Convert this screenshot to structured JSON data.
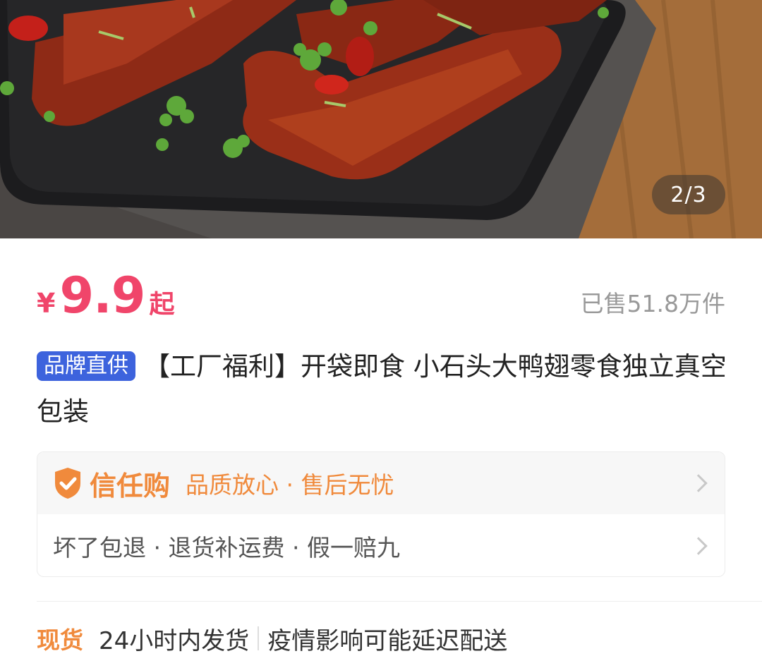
{
  "gallery": {
    "counter": "2/3",
    "image_desc_icon": "duck-wings-photo"
  },
  "price": {
    "currency": "¥",
    "amount": "9.9",
    "suffix": "起",
    "sold": "已售51.8万件",
    "color": "#f0456a"
  },
  "product": {
    "brand_tag": "品牌直供",
    "title": "【工厂福利】开袋即食 小石头大鸭翅零食独立真空包装"
  },
  "trust": {
    "brand": "信任购",
    "slogan": "品质放心 · 售后无忧",
    "terms": "坏了包退 · 退货补运费 · 假一赔九",
    "accent": "#f08a3c"
  },
  "shipping": {
    "tag": "现货",
    "text1": "24小时内发货",
    "text2": "疫情影响可能延迟配送"
  }
}
